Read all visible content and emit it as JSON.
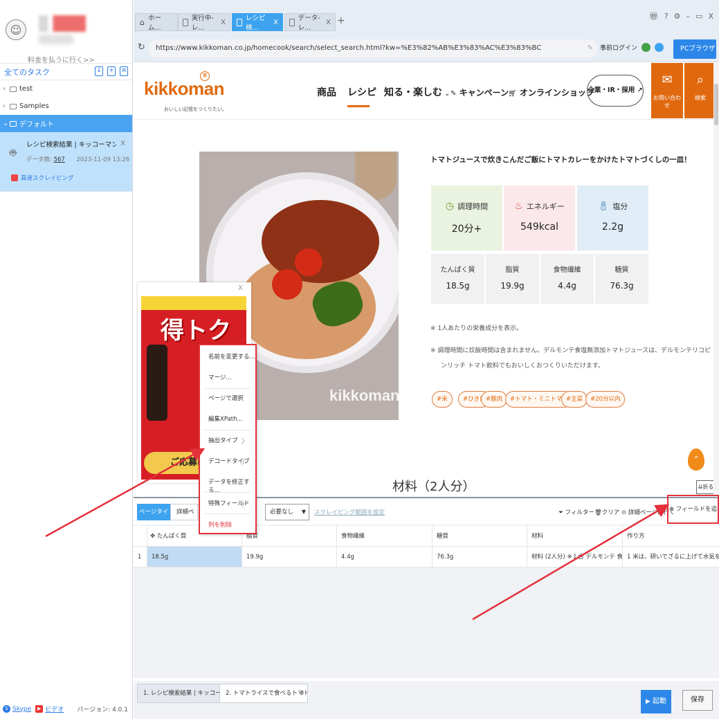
{
  "left": {
    "pay_link": "料金を払うに行く>>",
    "tasks_header": "全てのタスク",
    "tree": [
      {
        "label": "test",
        "expanded": false
      },
      {
        "label": "Samples",
        "expanded": false
      },
      {
        "label": "デフォルト",
        "expanded": true
      }
    ],
    "task": {
      "title": "レシピ検索結果 | キッコーマン株式会社-ス...",
      "data_label": "データ数:",
      "data_count": "567",
      "date": "2023-11-09 13:26",
      "cloud_label": "高速スクレイピング"
    },
    "footer": {
      "skype": "Skype",
      "video": "ビデオ",
      "version": "バージョン: 4.0.1"
    }
  },
  "browser": {
    "tabs": [
      {
        "label": "ホーム...",
        "active": false,
        "closable": false
      },
      {
        "label": "実行中-レ...",
        "active": false,
        "closable": true
      },
      {
        "label": "レシピ検...",
        "active": true,
        "closable": true
      },
      {
        "label": "データ-レ...",
        "active": false,
        "closable": true
      }
    ],
    "new_tab": "+",
    "url": "https://www.kikkoman.co.jp/homecook/search/select_search.html?kw=%E3%82%AB%E3%83%AC%E3%83%BC",
    "prelogin": "事前ログイン",
    "pc_browser": "PCブラウザ"
  },
  "site": {
    "logo": "kikkoman",
    "logo_seal": "実",
    "tagline": "おいしい記憶をつくりたい。",
    "nav": [
      "商品",
      "レシピ",
      "知る・楽しむ",
      "キャンペーン",
      "オンラインショップ"
    ],
    "corp_button": "企業・IR・採用",
    "contact": "お問い合わせ",
    "search": "検索",
    "photo_watermark": "kikkoman",
    "dish_title": "トマトジュースで炊きこんだご飯にトマトカレーをかけたトマトづくしの一皿！",
    "nutrition_main": [
      {
        "label": "調理時間",
        "value": "20分+",
        "color": "#eaf3df",
        "icon": "clock-icon"
      },
      {
        "label": "エネルギー",
        "value": "549kcal",
        "color": "#fbe8ea",
        "icon": "flame-icon"
      },
      {
        "label": "塩分",
        "value": "2.2g",
        "color": "#e0edf6",
        "icon": "salt-icon"
      }
    ],
    "nutrition_sub": [
      {
        "label": "たんぱく質",
        "value": "18.5g"
      },
      {
        "label": "脂質",
        "value": "19.9g"
      },
      {
        "label": "食物繊維",
        "value": "4.4g"
      },
      {
        "label": "糖質",
        "value": "76.3g"
      }
    ],
    "note1": "※ 1人あたりの栄養成分を表示。",
    "note2a": "※ 調理時間に炊飯時間は含まれません。デルモンテ食塩無添加トマトジュースは、デルモンテリコピ",
    "note2b": "ンリッチ トマト飲料でもおいしくおつくりいただけます。",
    "tags": [
      "#米",
      "#ひき肉",
      "#豚肉",
      "#トマト・ミニトマト",
      "#主菜",
      "#20分以内"
    ],
    "ingredients_heading": "材料（2人分）",
    "fold": "折る",
    "ad": {
      "headline": "得トク",
      "button": "ご応募は"
    }
  },
  "context_menu": {
    "items": [
      {
        "label": "名前を変更する...",
        "submenu": false
      },
      {
        "label": "マージ...",
        "submenu": false
      },
      {
        "label": "ページで選択",
        "submenu": false
      },
      {
        "label": "編集XPath...",
        "submenu": false
      },
      {
        "label": "抽出タイプ",
        "submenu": true
      },
      {
        "label": "デコードタイプ",
        "submenu": true
      },
      {
        "label": "データを修正する...",
        "submenu": false
      },
      {
        "label": "特殊フィールド",
        "submenu": true
      },
      {
        "label": "列を削除",
        "submenu": false,
        "danger": true
      }
    ]
  },
  "panel": {
    "page_type": "ページタイプ",
    "detail": "詳細ペー",
    "select_value": "必要なし",
    "scrape_range": "スクレイピング範囲を設定",
    "filter": "フィルター",
    "clear": "クリア",
    "goto_detail": "詳細ページに行く",
    "add_field": "フィールドを追加",
    "columns": [
      "たんぱく質",
      "脂質",
      "食物繊維",
      "糖質",
      "材料",
      "作り方"
    ],
    "rows": [
      {
        "index": "1",
        "cells": [
          "18.5g",
          "19.9g",
          "4.4g",
          "76.3g",
          "材料 (2人分) ※１合 デルモンテ 食塩...",
          "1 米は、研いでざるに上げて水気をきり、..."
        ]
      }
    ]
  },
  "bottom": {
    "tabs": [
      "1. レシピ検索結果 | キッコーマン...",
      "2. トマトライスで食べるトマトカ..."
    ],
    "start": "起動",
    "save": "保存"
  },
  "colors": {
    "accent_blue": "#3ea3ef",
    "brand_orange": "#e06a0e",
    "annotation_red": "#e3303a"
  }
}
